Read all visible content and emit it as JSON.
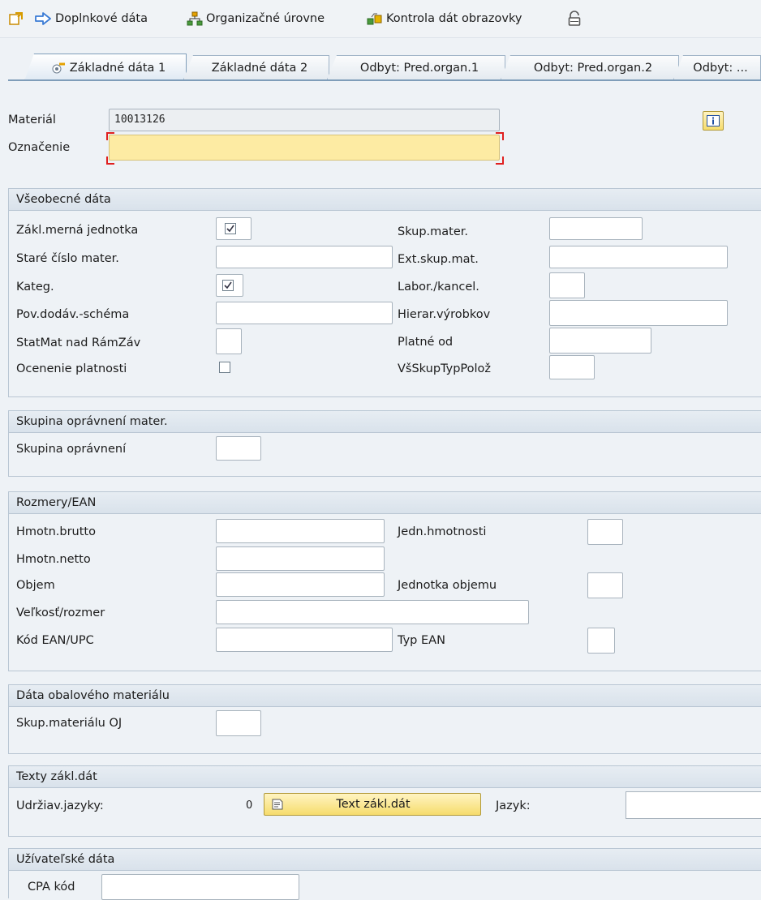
{
  "toolbar": {
    "additional_data": "Doplnkové dáta",
    "org_levels": "Organizačné úrovne",
    "check_screen": "Kontrola dát obrazovky"
  },
  "tabs": [
    {
      "label": "Základné dáta 1",
      "active": true
    },
    {
      "label": "Základné dáta 2"
    },
    {
      "label": "Odbyt: Pred.organ.1"
    },
    {
      "label": "Odbyt: Pred.organ.2"
    },
    {
      "label": "Odbyt: ..."
    }
  ],
  "header": {
    "material_label": "Materiál",
    "material_value": "10013126",
    "description_label": "Označenie",
    "description_value": ""
  },
  "general": {
    "title": "Všeobecné dáta",
    "base_unit": "Zákl.merná jednotka",
    "old_material": "Staré číslo mater.",
    "category": "Kateg.",
    "req_supplier": "Pov.dodáv.-schéma",
    "status_fw": "StatMat nad RámZáv",
    "valuation_validity": "Ocenenie platnosti",
    "material_group": "Skup.mater.",
    "ext_material_group": "Ext.skup.mat.",
    "lab_office": "Labor./kancel.",
    "product_hierarchy": "Hierar.výrobkov",
    "valid_from": "Platné od",
    "item_category_group": "VšSkupTypPolož"
  },
  "auth": {
    "title": "Skupina oprávnení mater.",
    "auth_group": "Skupina oprávnení"
  },
  "dimensions": {
    "title": "Rozmery/EAN",
    "gross_weight": "Hmotn.brutto",
    "net_weight": "Hmotn.netto",
    "volume": "Objem",
    "size_dim": "Veľkosť/rozmer",
    "ean_code": "Kód EAN/UPC",
    "weight_unit": "Jedn.hmotnosti",
    "volume_unit": "Jednotka objemu",
    "ean_type": "Typ EAN"
  },
  "packaging": {
    "title": "Dáta obalového materiálu",
    "pack_group": "Skup.materiálu OJ"
  },
  "texts": {
    "title": "Texty zákl.dát",
    "maint_languages": "Udržiav.jazyky:",
    "count": "0",
    "button": "Text zákl.dát",
    "language": "Jazyk:"
  },
  "user": {
    "title": "Užívateľské dáta",
    "cpa": "CPA kód"
  },
  "colors": {
    "required_field": "#fdeba3",
    "button_gold": "#f6dc6c",
    "background": "#eef2f6"
  }
}
